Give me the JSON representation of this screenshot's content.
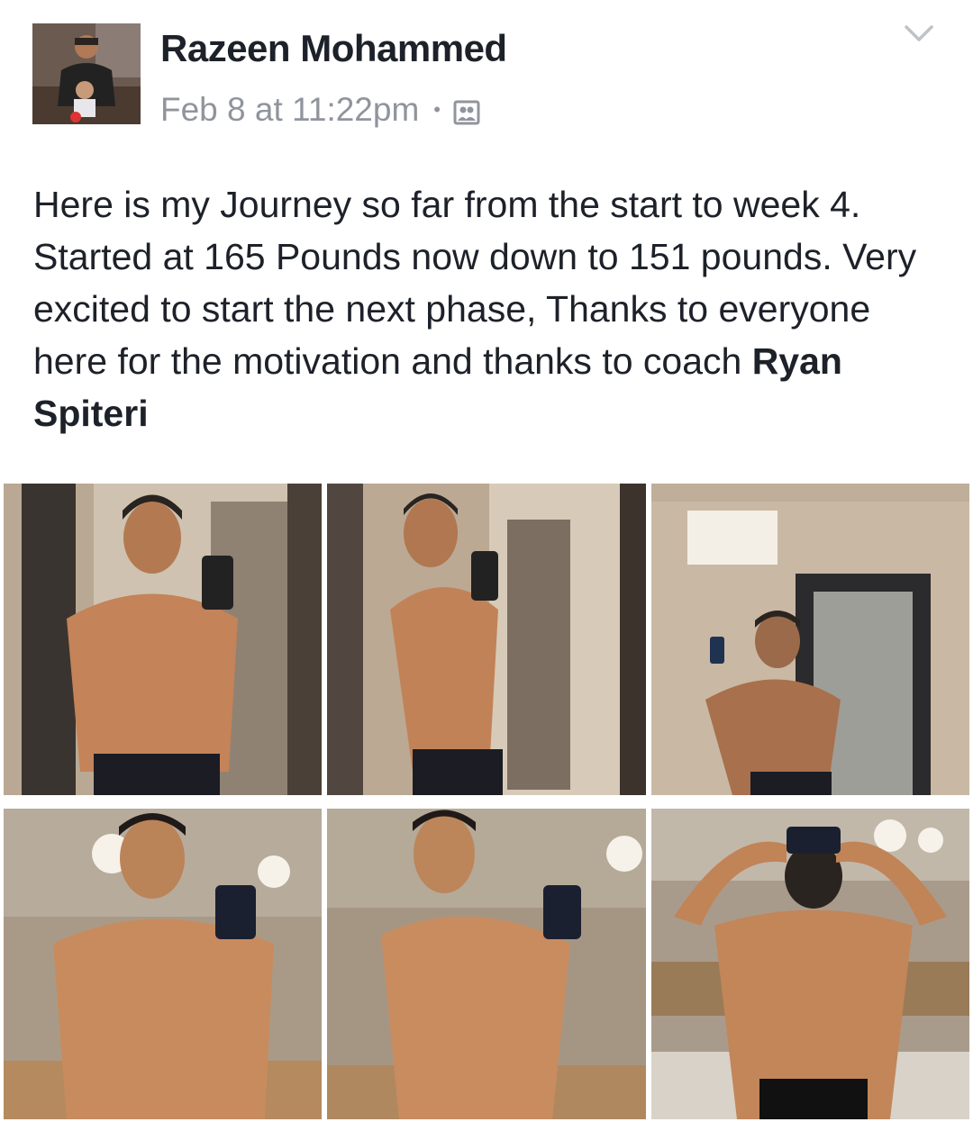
{
  "post": {
    "author": "Razeen Mohammed",
    "timestamp": "Feb 8 at 11:22pm",
    "separator": "•",
    "privacy_icon": "group-audience-icon",
    "menu_icon": "chevron-down-icon",
    "text_main": "Here is my Journey so far from the start to week 4. Started at 165 Pounds now down to 151 pounds. Very excited to start the next phase, Thanks to everyone here for the motivation and thanks to coach ",
    "mention": "Ryan Spiteri"
  },
  "photos": [
    {
      "name": "photo-front-before"
    },
    {
      "name": "photo-side-before"
    },
    {
      "name": "photo-back-before"
    },
    {
      "name": "photo-front-after"
    },
    {
      "name": "photo-side-after"
    },
    {
      "name": "photo-back-after"
    }
  ],
  "colors": {
    "text": "#1d2129",
    "meta": "#90949c",
    "skin": "#c98a5e"
  }
}
